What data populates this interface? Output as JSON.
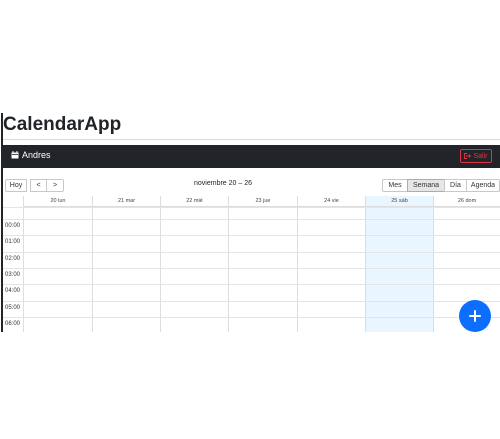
{
  "app_title": "CalendarApp",
  "navbar": {
    "user_icon": "calendar-icon",
    "user_name": "Andres",
    "logout_icon": "sign-out-icon",
    "logout_label": "Salir"
  },
  "toolbar": {
    "today_label": "Hoy",
    "prev_label": "<",
    "next_label": ">",
    "range_label": "noviembre 20 – 26",
    "views": [
      {
        "label": "Mes",
        "active": false
      },
      {
        "label": "Semana",
        "active": true
      },
      {
        "label": "Día",
        "active": false
      },
      {
        "label": "Agenda",
        "active": false
      }
    ]
  },
  "days": [
    "20 lun",
    "21 mar",
    "22 mié",
    "23 jue",
    "24 vie",
    "25 sáb",
    "26 dom"
  ],
  "today_label": "25 sáb",
  "hours": [
    "00:00",
    "01:00",
    "02:00",
    "03:00",
    "04:00",
    "05:00",
    "06:00"
  ],
  "fab": {
    "icon": "plus-icon"
  },
  "colors": {
    "navbar": "#212529",
    "danger": "#dc3545",
    "primary": "#0d6efd",
    "today_bg": "#eaf6ff"
  }
}
